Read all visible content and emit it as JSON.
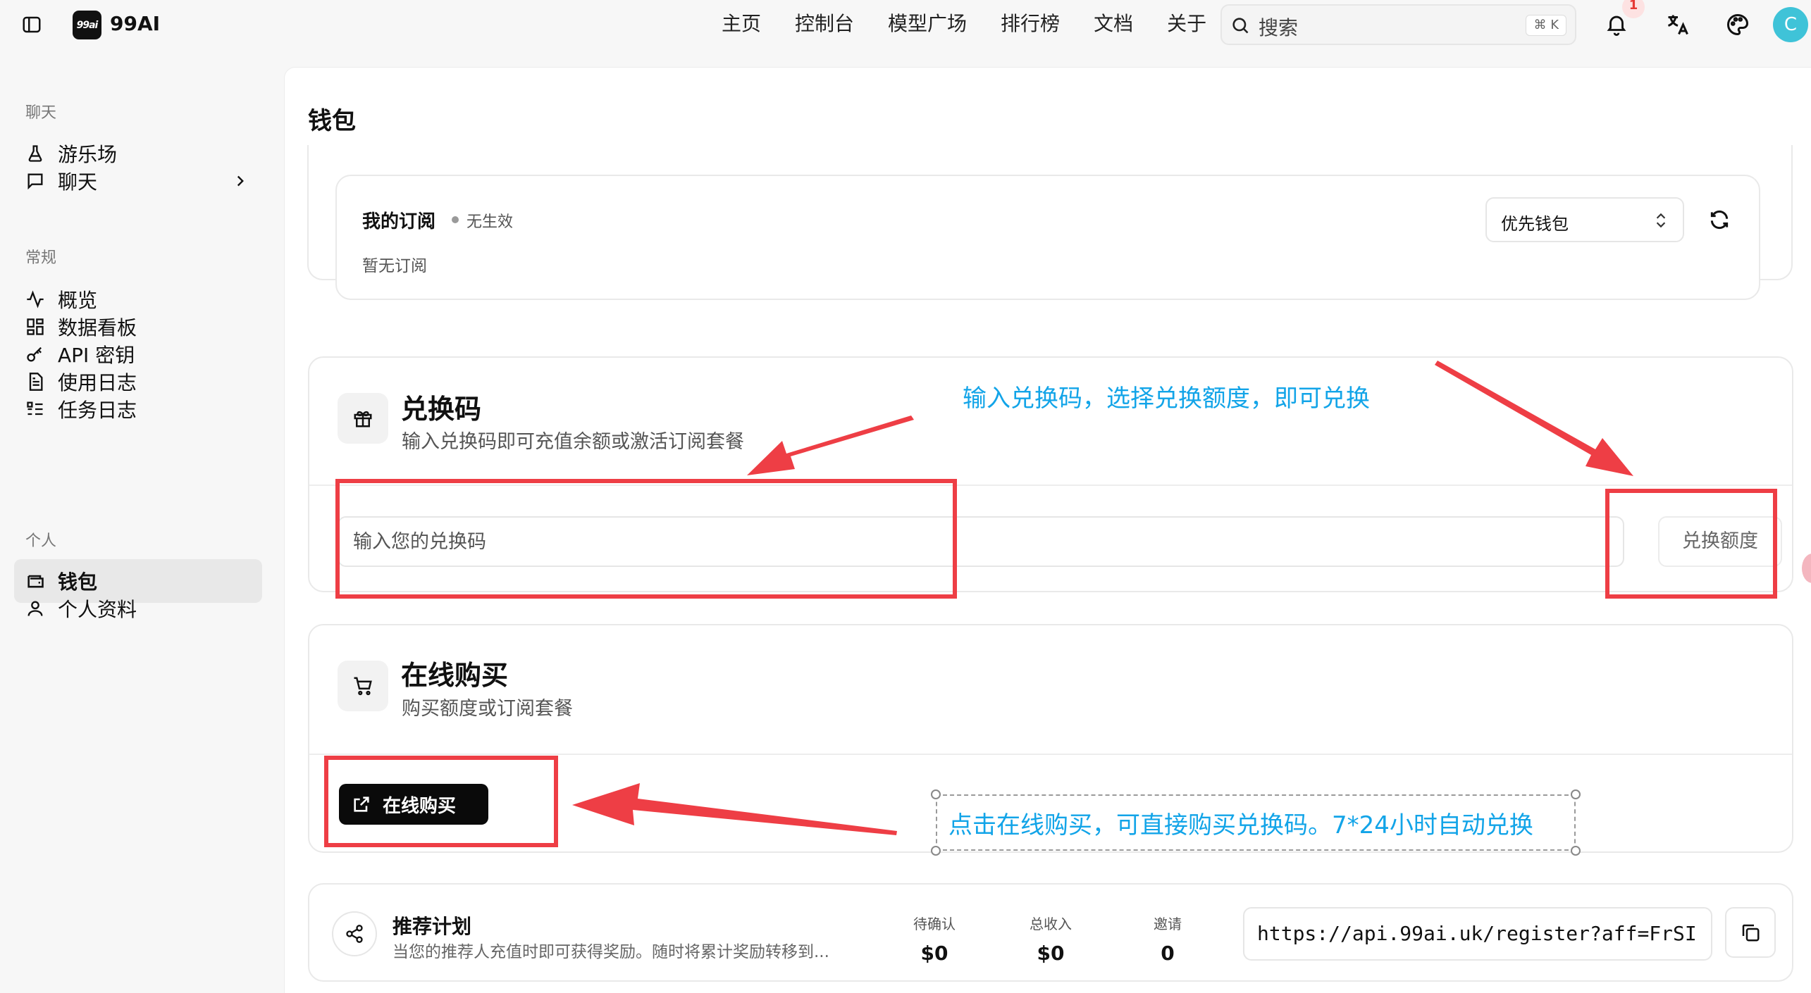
{
  "header": {
    "brand_logo_text": "99ai",
    "brand_name": "99AI",
    "nav": [
      "主页",
      "控制台",
      "模型广场",
      "排行榜",
      "文档",
      "关于"
    ],
    "search_placeholder": "搜索",
    "search_shortcut": "⌘ K",
    "notification_count": "1",
    "avatar_initial": "C"
  },
  "sidebar": {
    "sections": [
      {
        "title": "聊天",
        "items": [
          {
            "label": "游乐场",
            "icon": "flask-icon"
          },
          {
            "label": "聊天",
            "icon": "message-square-icon",
            "has_submenu": true
          }
        ]
      },
      {
        "title": "常规",
        "items": [
          {
            "label": "概览",
            "icon": "activity-icon"
          },
          {
            "label": "数据看板",
            "icon": "dashboard-grid-icon"
          },
          {
            "label": "API 密钥",
            "icon": "key-icon"
          },
          {
            "label": "使用日志",
            "icon": "file-text-icon"
          },
          {
            "label": "任务日志",
            "icon": "list-todo-icon"
          }
        ]
      },
      {
        "title": "个人",
        "items": [
          {
            "label": "钱包",
            "icon": "wallet-icon",
            "active": true
          },
          {
            "label": "个人资料",
            "icon": "user-icon"
          }
        ]
      }
    ]
  },
  "main": {
    "title": "钱包",
    "subscription": {
      "title": "我的订阅",
      "status": "无生效",
      "empty_text": "暂无订阅",
      "wallet_select_value": "优先钱包"
    },
    "redeem": {
      "title": "兑换码",
      "subtitle": "输入兑换码即可充值余额或激活订阅套餐",
      "input_placeholder": "输入您的兑换码",
      "amount_button": "兑换额度"
    },
    "buy": {
      "title": "在线购买",
      "subtitle": "购买额度或订阅套餐",
      "button": "在线购买"
    },
    "referral": {
      "title": "推荐计划",
      "description": "当您的推荐人充值时即可获得奖励。随时将累计奖励转移到...",
      "stats": [
        {
          "label": "待确认",
          "value": "$0"
        },
        {
          "label": "总收入",
          "value": "$0"
        },
        {
          "label": "邀请",
          "value": "0"
        }
      ],
      "link": "https://api.99ai.uk/register?aff=FrSI"
    }
  },
  "annotations": {
    "redeem_hint": "输入兑换码，选择兑换额度，即可兑换",
    "buy_hint": "点击在线购买，可直接购买兑换码。7*24小时自动兑换",
    "highlight_color": "#ee3e45",
    "text_color": "#12a4e8"
  }
}
